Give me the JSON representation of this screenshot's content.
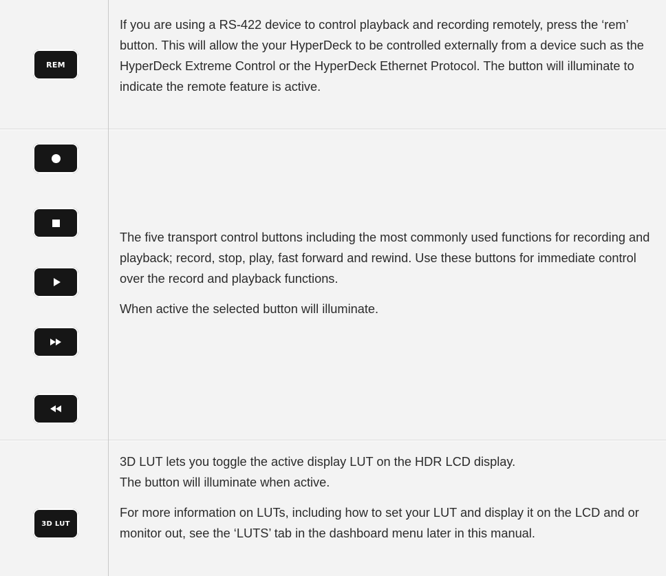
{
  "rem_row": {
    "button_label": "REM",
    "description": "If you are using a RS-422 device to control playback and recording remotely, press the ‘rem’ button. This will allow the your HyperDeck to be controlled externally from a device such as the HyperDeck Extreme Control or the HyperDeck Ethernet Protocol. The button will illuminate to indicate the remote feature is active."
  },
  "transport_row": {
    "buttons": [
      {
        "icon": "record-icon"
      },
      {
        "icon": "stop-icon"
      },
      {
        "icon": "play-icon"
      },
      {
        "icon": "fast-forward-icon"
      },
      {
        "icon": "rewind-icon"
      }
    ],
    "description": "The five transport control buttons including the most commonly used functions for recording and playback; record, stop, play, fast forward and rewind. Use these buttons for immediate control over the record and playback functions.",
    "note": "When active the selected button will illuminate."
  },
  "lut_row": {
    "button_label": "3D LUT",
    "description_line1": "3D LUT lets you toggle the active display LUT on the HDR LCD display.",
    "description_line2": "The button will illuminate when active.",
    "more_info": "For more information on LUTs, including how to set your LUT and display it on the LCD and or monitor out, see the ‘LUTS’ tab in the dashboard menu later in this manual."
  }
}
